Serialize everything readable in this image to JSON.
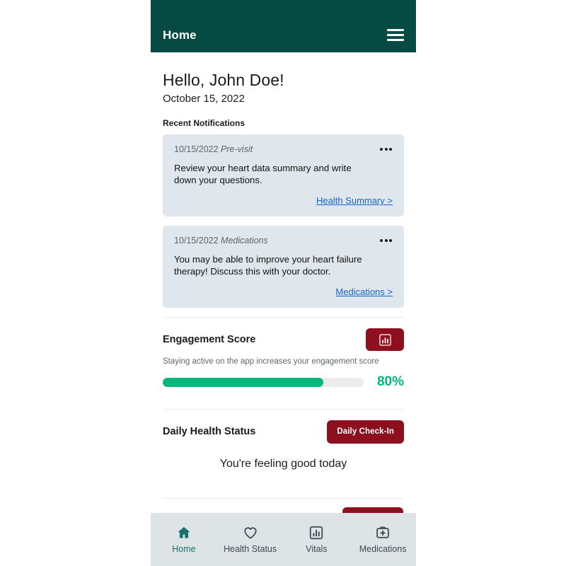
{
  "header": {
    "title": "Home",
    "menu_icon": "hamburger-menu-icon"
  },
  "greeting": {
    "hello": "Hello, John Doe!",
    "date": "October 15, 2022"
  },
  "notifications": {
    "section_label": "Recent Notifications",
    "items": [
      {
        "date": "10/15/2022",
        "category": "Pre-visit",
        "body": "Review your heart data summary and write down your questions.",
        "link": "Health Summary >",
        "overflow_icon": "more-options-icon"
      },
      {
        "date": "10/15/2022",
        "category": "Medications",
        "body": "You may be able to improve your heart failure therapy! Discuss this with your doctor.",
        "link": "Medications >",
        "overflow_icon": "more-options-icon"
      }
    ]
  },
  "engagement": {
    "title": "Engagement Score",
    "chart_button_icon": "bar-chart-icon",
    "helper": "Staying active on the app increases your engagement score",
    "percent_label": "80%",
    "percent_value": 80,
    "fill_color": "#03b878",
    "track_color": "#ececec"
  },
  "daily_status": {
    "title": "Daily Health Status",
    "check_in_label": "Daily Check-In",
    "message": "You're feeling good today"
  },
  "bottom_nav": {
    "items": [
      {
        "label": "Home",
        "icon": "home-icon",
        "active": true
      },
      {
        "label": "Health Status",
        "icon": "heart-icon",
        "active": false
      },
      {
        "label": "Vitals",
        "icon": "bar-chart-square-icon",
        "active": false
      },
      {
        "label": "Medications",
        "icon": "medical-kit-icon",
        "active": false
      }
    ]
  },
  "colors": {
    "header_teal": "#064a44",
    "accent_red": "#8d101f",
    "link_blue": "#1464c8",
    "card_bg": "#dfe7ec",
    "nav_bg": "#dee3e6",
    "nav_active": "#16706b"
  }
}
